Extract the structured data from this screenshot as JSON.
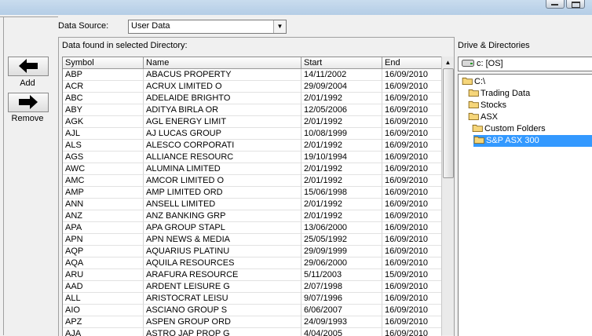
{
  "window": {
    "min_icon": "minimize-icon",
    "max_icon": "restore-icon"
  },
  "data_source": {
    "label": "Data Source:",
    "value": "User Data"
  },
  "buttons": {
    "add_label": "Add",
    "remove_label": "Remove"
  },
  "grid": {
    "caption": "Data found in selected Directory:",
    "columns": [
      "Symbol",
      "Name",
      "Start",
      "End"
    ],
    "rows": [
      [
        "ABP",
        "ABACUS PROPERTY",
        "14/11/2002",
        "16/09/2010"
      ],
      [
        "ACR",
        "ACRUX LIMITED  O",
        "29/09/2004",
        "16/09/2010"
      ],
      [
        "ABC",
        "ADELAIDE BRIGHTO",
        "2/01/1992",
        "16/09/2010"
      ],
      [
        "ABY",
        "ADITYA BIRLA  OR",
        "12/05/2006",
        "16/09/2010"
      ],
      [
        "AGK",
        "AGL ENERGY LIMIT",
        "2/01/1992",
        "16/09/2010"
      ],
      [
        "AJL",
        "AJ LUCAS GROUP",
        "10/08/1999",
        "16/09/2010"
      ],
      [
        "ALS",
        "ALESCO CORPORATI",
        "2/01/1992",
        "16/09/2010"
      ],
      [
        "AGS",
        "ALLIANCE RESOURC",
        "19/10/1994",
        "16/09/2010"
      ],
      [
        "AWC",
        "ALUMINA LIMITED",
        "2/01/1992",
        "16/09/2010"
      ],
      [
        "AMC",
        "AMCOR LIMITED  O",
        "2/01/1992",
        "16/09/2010"
      ],
      [
        "AMP",
        "AMP LIMITED  ORD",
        "15/06/1998",
        "16/09/2010"
      ],
      [
        "ANN",
        "ANSELL LIMITED",
        "2/01/1992",
        "16/09/2010"
      ],
      [
        "ANZ",
        "ANZ BANKING GRP",
        "2/01/1992",
        "16/09/2010"
      ],
      [
        "APA",
        "APA GROUP  STAPL",
        "13/06/2000",
        "16/09/2010"
      ],
      [
        "APN",
        "APN NEWS & MEDIA",
        "25/05/1992",
        "16/09/2010"
      ],
      [
        "AQP",
        "AQUARIUS PLATINU",
        "29/09/1999",
        "16/09/2010"
      ],
      [
        "AQA",
        "AQUILA RESOURCES",
        "29/06/2000",
        "16/09/2010"
      ],
      [
        "ARU",
        "ARAFURA RESOURCE",
        "5/11/2003",
        "15/09/2010"
      ],
      [
        "AAD",
        "ARDENT LEISURE G",
        "2/07/1998",
        "16/09/2010"
      ],
      [
        "ALL",
        "ARISTOCRAT LEISU",
        "9/07/1996",
        "16/09/2010"
      ],
      [
        "AIO",
        "ASCIANO GROUP  S",
        "6/06/2007",
        "16/09/2010"
      ],
      [
        "APZ",
        "ASPEN GROUP  ORD",
        "24/09/1993",
        "16/09/2010"
      ],
      [
        "AJA",
        "ASTRO JAP PROP G",
        "4/04/2005",
        "16/09/2010"
      ]
    ]
  },
  "drives": {
    "label": "Drive & Directories",
    "selected_drive": "c: [OS]",
    "tree": [
      "C:\\",
      "Trading Data",
      "Stocks",
      "ASX",
      "Custom Folders",
      "S&P ASX 300"
    ],
    "selected_folder": "S&P ASX 300"
  }
}
